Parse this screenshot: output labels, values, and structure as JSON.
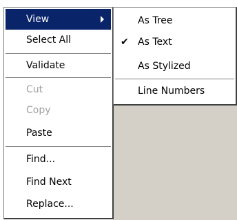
{
  "main_menu": {
    "items": [
      {
        "label": "View",
        "state": "highlighted",
        "has_submenu": true
      },
      {
        "label": "Select All"
      },
      {
        "label": "Validate"
      },
      {
        "label": "Cut",
        "state": "disabled"
      },
      {
        "label": "Copy",
        "state": "disabled"
      },
      {
        "label": "Paste"
      },
      {
        "label": "Find..."
      },
      {
        "label": "Find Next"
      },
      {
        "label": "Replace..."
      }
    ]
  },
  "view_submenu": {
    "items": [
      {
        "label": "As Tree",
        "checked": false
      },
      {
        "label": "As Text",
        "checked": true
      },
      {
        "label": "As Stylized",
        "checked": false
      },
      {
        "label": "Line Numbers",
        "checked": false
      }
    ],
    "check_glyph": "✔"
  },
  "colors": {
    "highlight_bg": "#0a246a",
    "highlight_text": "#ffffff",
    "disabled_text": "#a0a0a0",
    "window_bg": "#d4d0c8"
  }
}
